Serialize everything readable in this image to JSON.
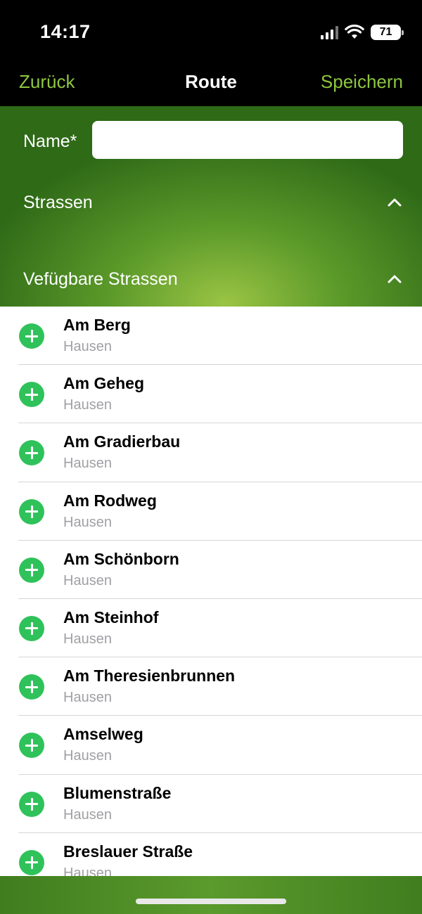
{
  "status_bar": {
    "time": "14:17",
    "battery": "71"
  },
  "nav": {
    "back_label": "Zurück",
    "title": "Route",
    "save_label": "Speichern"
  },
  "form": {
    "name_label": "Name*",
    "name_value": "",
    "name_placeholder": ""
  },
  "sections": {
    "streets_label": "Strassen",
    "available_label": "Vefügbare Strassen"
  },
  "available_streets": [
    {
      "name": "Am Berg",
      "town": "Hausen"
    },
    {
      "name": "Am Geheg",
      "town": "Hausen"
    },
    {
      "name": "Am Gradierbau",
      "town": "Hausen"
    },
    {
      "name": "Am Rodweg",
      "town": "Hausen"
    },
    {
      "name": "Am Schönborn",
      "town": "Hausen"
    },
    {
      "name": "Am Steinhof",
      "town": "Hausen"
    },
    {
      "name": "Am Theresienbrunnen",
      "town": "Hausen"
    },
    {
      "name": "Amselweg",
      "town": "Hausen"
    },
    {
      "name": "Blumenstraße",
      "town": "Hausen"
    },
    {
      "name": "Breslauer Straße",
      "town": "Hausen"
    }
  ],
  "colors": {
    "accent": "#8dc63f",
    "add_button": "#2fc25a",
    "header_green": "#5c9a2a"
  },
  "icons": {
    "add": "plus-circle-icon",
    "collapse": "chevron-up-icon",
    "signal": "cellular-signal-icon",
    "wifi": "wifi-icon",
    "battery": "battery-icon"
  }
}
